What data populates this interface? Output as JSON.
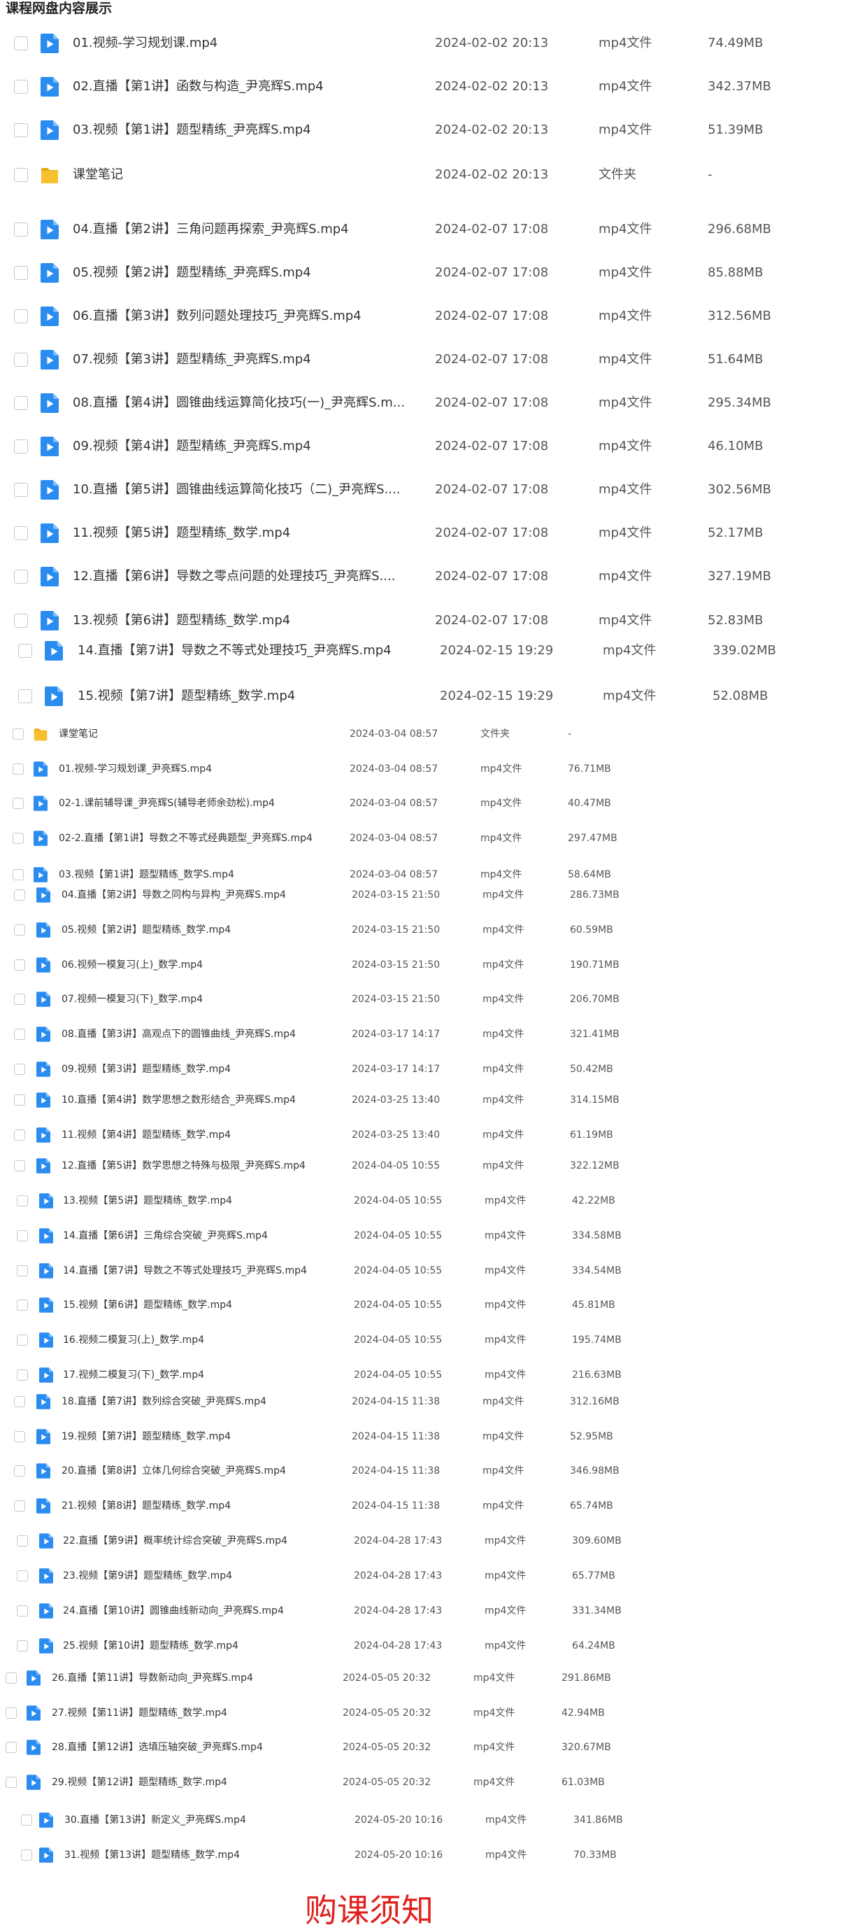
{
  "page_title": "课程网盘内容展示",
  "icons": {
    "video": "video-file-icon",
    "folder": "folder-icon"
  },
  "colors": {
    "video_icon": "#2b8cf0",
    "folder_icon": "#f7c02d",
    "banner": "#e0201c"
  },
  "files": [
    {
      "icon": "video",
      "name": "01.视频-学习规划课.mp4",
      "date": "2024-02-02 20:13",
      "type": "mp4文件",
      "size": "74.49MB"
    },
    {
      "icon": "video",
      "name": "02.直播【第1讲】函数与构造_尹亮辉S.mp4",
      "date": "2024-02-02 20:13",
      "type": "mp4文件",
      "size": "342.37MB"
    },
    {
      "icon": "video",
      "name": "03.视频【第1讲】题型精练_尹亮辉S.mp4",
      "date": "2024-02-02 20:13",
      "type": "mp4文件",
      "size": "51.39MB"
    },
    {
      "icon": "folder",
      "name": "课堂笔记",
      "date": "2024-02-02 20:13",
      "type": "文件夹",
      "size": "-"
    },
    {
      "icon": "video",
      "name": "04.直播【第2讲】三角问题再探索_尹亮辉S.mp4",
      "date": "2024-02-07 17:08",
      "type": "mp4文件",
      "size": "296.68MB"
    },
    {
      "icon": "video",
      "name": "05.视频【第2讲】题型精练_尹亮辉S.mp4",
      "date": "2024-02-07 17:08",
      "type": "mp4文件",
      "size": "85.88MB"
    },
    {
      "icon": "video",
      "name": "06.直播【第3讲】数列问题处理技巧_尹亮辉S.mp4",
      "date": "2024-02-07 17:08",
      "type": "mp4文件",
      "size": "312.56MB"
    },
    {
      "icon": "video",
      "name": "07.视频【第3讲】题型精练_尹亮辉S.mp4",
      "date": "2024-02-07 17:08",
      "type": "mp4文件",
      "size": "51.64MB"
    },
    {
      "icon": "video",
      "name": "08.直播【第4讲】圆锥曲线运算简化技巧(一)_尹亮辉S.m...",
      "date": "2024-02-07 17:08",
      "type": "mp4文件",
      "size": "295.34MB"
    },
    {
      "icon": "video",
      "name": "09.视频【第4讲】题型精练_尹亮辉S.mp4",
      "date": "2024-02-07 17:08",
      "type": "mp4文件",
      "size": "46.10MB"
    },
    {
      "icon": "video",
      "name": "10.直播【第5讲】圆锥曲线运算简化技巧（二)_尹亮辉S....",
      "date": "2024-02-07 17:08",
      "type": "mp4文件",
      "size": "302.56MB"
    },
    {
      "icon": "video",
      "name": "11.视频【第5讲】题型精练_数学.mp4",
      "date": "2024-02-07 17:08",
      "type": "mp4文件",
      "size": "52.17MB"
    },
    {
      "icon": "video",
      "name": "12.直播【第6讲】导数之零点问题的处理技巧_尹亮辉S....",
      "date": "2024-02-07 17:08",
      "type": "mp4文件",
      "size": "327.19MB"
    },
    {
      "icon": "video",
      "name": "13.视频【第6讲】题型精练_数学.mp4",
      "date": "2024-02-07 17:08",
      "type": "mp4文件",
      "size": "52.83MB"
    },
    {
      "icon": "video",
      "name": "14.直播【第7讲】导数之不等式处理技巧_尹亮辉S.mp4",
      "date": "2024-02-15 19:29",
      "type": "mp4文件",
      "size": "339.02MB"
    },
    {
      "icon": "video",
      "name": "15.视频【第7讲】题型精练_数学.mp4",
      "date": "2024-02-15 19:29",
      "type": "mp4文件",
      "size": "52.08MB"
    },
    {
      "icon": "folder",
      "name": "课堂笔记",
      "date": "2024-03-04 08:57",
      "type": "文件夹",
      "size": "-"
    },
    {
      "icon": "video",
      "name": "01.视频-学习规划课_尹亮辉S.mp4",
      "date": "2024-03-04 08:57",
      "type": "mp4文件",
      "size": "76.71MB"
    },
    {
      "icon": "video",
      "name": "02-1.课前辅导课_尹亮辉S(辅导老师余劲松).mp4",
      "date": "2024-03-04 08:57",
      "type": "mp4文件",
      "size": "40.47MB"
    },
    {
      "icon": "video",
      "name": "02-2.直播【第1讲】导数之不等式经典题型_尹亮辉S.mp4",
      "date": "2024-03-04 08:57",
      "type": "mp4文件",
      "size": "297.47MB"
    },
    {
      "icon": "video",
      "name": "03.视频【第1讲】题型精练_数学S.mp4",
      "date": "2024-03-04 08:57",
      "type": "mp4文件",
      "size": "58.64MB"
    },
    {
      "icon": "video",
      "name": "04.直播【第2讲】导数之同构与异构_尹亮辉S.mp4",
      "date": "2024-03-15 21:50",
      "type": "mp4文件",
      "size": "286.73MB"
    },
    {
      "icon": "video",
      "name": "05.视频【第2讲】题型精练_数学.mp4",
      "date": "2024-03-15 21:50",
      "type": "mp4文件",
      "size": "60.59MB"
    },
    {
      "icon": "video",
      "name": "06.视频一模复习(上)_数学.mp4",
      "date": "2024-03-15 21:50",
      "type": "mp4文件",
      "size": "190.71MB"
    },
    {
      "icon": "video",
      "name": "07.视频一模复习(下)_数学.mp4",
      "date": "2024-03-15 21:50",
      "type": "mp4文件",
      "size": "206.70MB"
    },
    {
      "icon": "video",
      "name": "08.直播【第3讲】高观点下的圆锥曲线_尹亮辉S.mp4",
      "date": "2024-03-17 14:17",
      "type": "mp4文件",
      "size": "321.41MB"
    },
    {
      "icon": "video",
      "name": "09.视频【第3讲】题型精练_数学.mp4",
      "date": "2024-03-17 14:17",
      "type": "mp4文件",
      "size": "50.42MB"
    },
    {
      "icon": "video",
      "name": "10.直播【第4讲】数学思想之数形结合_尹亮辉S.mp4",
      "date": "2024-03-25 13:40",
      "type": "mp4文件",
      "size": "314.15MB"
    },
    {
      "icon": "video",
      "name": "11.视频【第4讲】题型精练_数学.mp4",
      "date": "2024-03-25 13:40",
      "type": "mp4文件",
      "size": "61.19MB"
    },
    {
      "icon": "video",
      "name": "12.直播【第5讲】数学思想之特殊与极限_尹亮辉S.mp4",
      "date": "2024-04-05 10:55",
      "type": "mp4文件",
      "size": "322.12MB"
    },
    {
      "icon": "video",
      "name": "13.视频【第5讲】题型精练_数学.mp4",
      "date": "2024-04-05 10:55",
      "type": "mp4文件",
      "size": "42.22MB"
    },
    {
      "icon": "video",
      "name": "14.直播【第6讲】三角综合突破_尹亮辉S.mp4",
      "date": "2024-04-05 10:55",
      "type": "mp4文件",
      "size": "334.58MB"
    },
    {
      "icon": "video",
      "name": "14.直播【第7讲】导数之不等式处理技巧_尹亮辉S.mp4",
      "date": "2024-04-05 10:55",
      "type": "mp4文件",
      "size": "334.54MB"
    },
    {
      "icon": "video",
      "name": "15.视频【第6讲】题型精练_数学.mp4",
      "date": "2024-04-05 10:55",
      "type": "mp4文件",
      "size": "45.81MB"
    },
    {
      "icon": "video",
      "name": "16.视频二模复习(上)_数学.mp4",
      "date": "2024-04-05 10:55",
      "type": "mp4文件",
      "size": "195.74MB"
    },
    {
      "icon": "video",
      "name": "17.视频二模复习(下)_数学.mp4",
      "date": "2024-04-05 10:55",
      "type": "mp4文件",
      "size": "216.63MB"
    },
    {
      "icon": "video",
      "name": "18.直播【第7讲】数列综合突破_尹亮辉S.mp4",
      "date": "2024-04-15 11:38",
      "type": "mp4文件",
      "size": "312.16MB"
    },
    {
      "icon": "video",
      "name": "19.视频【第7讲】题型精练_数学.mp4",
      "date": "2024-04-15 11:38",
      "type": "mp4文件",
      "size": "52.95MB"
    },
    {
      "icon": "video",
      "name": "20.直播【第8讲】立体几何综合突破_尹亮辉S.mp4",
      "date": "2024-04-15 11:38",
      "type": "mp4文件",
      "size": "346.98MB"
    },
    {
      "icon": "video",
      "name": "21.视频【第8讲】题型精练_数学.mp4",
      "date": "2024-04-15 11:38",
      "type": "mp4文件",
      "size": "65.74MB"
    },
    {
      "icon": "video",
      "name": "22.直播【第9讲】概率统计综合突破_尹亮辉S.mp4",
      "date": "2024-04-28 17:43",
      "type": "mp4文件",
      "size": "309.60MB"
    },
    {
      "icon": "video",
      "name": "23.视频【第9讲】题型精练_数学.mp4",
      "date": "2024-04-28 17:43",
      "type": "mp4文件",
      "size": "65.77MB"
    },
    {
      "icon": "video",
      "name": "24.直播【第10讲】圆锥曲线新动向_尹亮辉S.mp4",
      "date": "2024-04-28 17:43",
      "type": "mp4文件",
      "size": "331.34MB"
    },
    {
      "icon": "video",
      "name": "25.视频【第10讲】题型精练_数学.mp4",
      "date": "2024-04-28 17:43",
      "type": "mp4文件",
      "size": "64.24MB"
    },
    {
      "icon": "video",
      "name": "26.直播【第11讲】导数新动向_尹亮辉S.mp4",
      "date": "2024-05-05 20:32",
      "type": "mp4文件",
      "size": "291.86MB"
    },
    {
      "icon": "video",
      "name": "27.视频【第11讲】题型精练_数学.mp4",
      "date": "2024-05-05 20:32",
      "type": "mp4文件",
      "size": "42.94MB"
    },
    {
      "icon": "video",
      "name": "28.直播【第12讲】选填压轴突破_尹亮辉S.mp4",
      "date": "2024-05-05 20:32",
      "type": "mp4文件",
      "size": "320.67MB"
    },
    {
      "icon": "video",
      "name": "29.视频【第12讲】题型精练_数学.mp4",
      "date": "2024-05-05 20:32",
      "type": "mp4文件",
      "size": "61.03MB"
    },
    {
      "icon": "video",
      "name": "30.直播【第13讲】新定义_尹亮辉S.mp4",
      "date": "2024-05-20 10:16",
      "type": "mp4文件",
      "size": "341.86MB"
    },
    {
      "icon": "video",
      "name": "31.视频【第13讲】题型精练_数学.mp4",
      "date": "2024-05-20 10:16",
      "type": "mp4文件",
      "size": "70.33MB"
    }
  ],
  "bottom_banner": "购课须知"
}
